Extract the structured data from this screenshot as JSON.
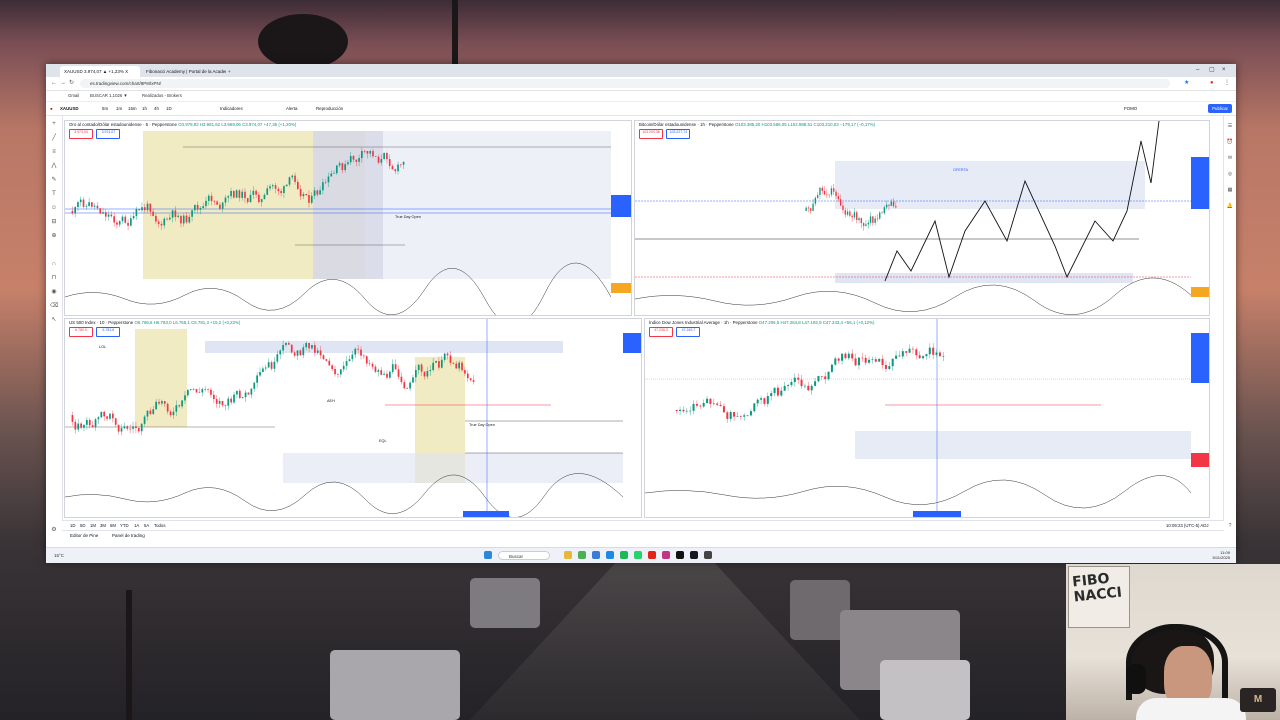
{
  "browser": {
    "tabs": [
      {
        "label": "XAUUSD 3.974,07 ▲ +1,23% X"
      },
      {
        "label": "Fibonacci Academy | Portal de la Academia"
      }
    ],
    "new_tab": "+",
    "window_controls": [
      "–",
      "▢",
      "×"
    ],
    "url": "es.tradingview.com/chart/8P8rlxPN/",
    "bookmarks": [
      {
        "label": "Gmail"
      },
      {
        "label": "BUSCAR 1,1026 ▼"
      },
      {
        "label": "Realizados - Brokers"
      }
    ]
  },
  "toolbar": {
    "symbol": "XAUUSD",
    "interval": "5m",
    "items": [
      "1m",
      "15m",
      "1h",
      "4h",
      "1D",
      "Indicadores",
      "Alerta",
      "Reproducción"
    ],
    "right_items": [
      "FOMO",
      "Publicar"
    ]
  },
  "panes": [
    {
      "title": "Oro al contado/Dólar estadounidense · 5 · Pepperstone",
      "ohlc": "O3.978,92 H3.981,62 L3.969,06 C3.974,07 +47,36 (+1,20%)",
      "sell": "3.973,93",
      "buy": "3.974,07",
      "notes": [
        "True Day Open"
      ]
    },
    {
      "title": "Bitcoin/Dólar estadounidense · 1h · Pepperstone",
      "ohlc": "O103.385,20 H103.566,05 L102.988,51 C103.210,03 −179,17 (−0,17%)",
      "sell": "103.200,38",
      "buy": "103.227,74",
      "notes": [
        "OFERTA"
      ]
    },
    {
      "title": "US 500 Index · 10 · Pepperstone",
      "ohlc": "O6.766,6 H6.783,0 L6.765,1 C6.781,3 +15,2 (+0,22%)",
      "sell": "6.780,9",
      "buy": "6.781,6",
      "notes": [
        "LOL",
        "EQL",
        "AEH",
        "True Day Open"
      ]
    },
    {
      "title": "Índice Dow Jones Industrial Average · 1h · Pepperstone",
      "ohlc": "O47.206,5 H47.264,8 L47.192,9 C47.243,4 +56,1 (+0,12%)",
      "sell": "47.236,3",
      "buy": "47.249,7",
      "notes": []
    }
  ],
  "bottom_bar": {
    "ranges": [
      "1D",
      "5D",
      "1M",
      "3M",
      "6M",
      "YTD",
      "1A",
      "5A",
      "Todos"
    ],
    "right": "10:09:23 (UTC-5)   ADJ"
  },
  "footer": {
    "items": [
      "Editor de Pine",
      "Panel de trading"
    ]
  },
  "taskbar": {
    "search_placeholder": "Buscar",
    "weather": "15°C",
    "clock_time": "11:09",
    "clock_date": "5/11/2025"
  },
  "webcam": {
    "poster_text": "FIBO\nNACCI"
  },
  "colors": {
    "up": "#089981",
    "down": "#f23645",
    "accent": "#2962ff",
    "session_zone": "#eee7b8",
    "range_zone": "#dde2f2"
  }
}
